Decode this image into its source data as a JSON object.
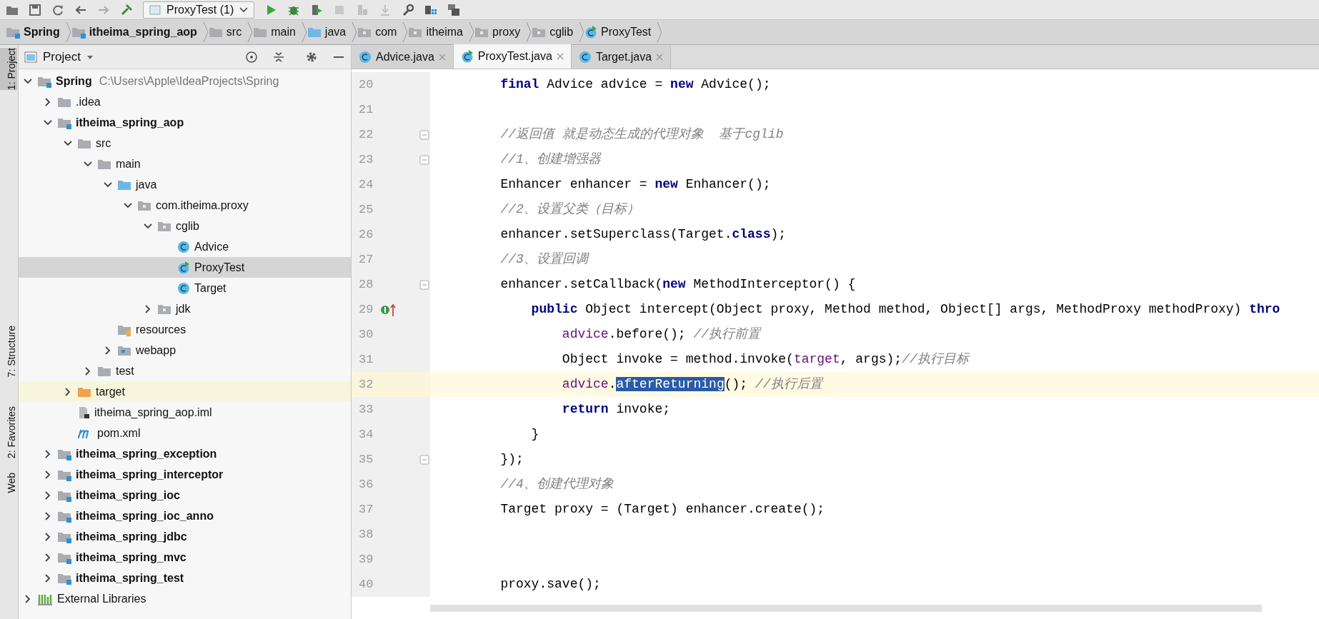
{
  "toolbar": {
    "run_config": "ProxyTest (1)"
  },
  "breadcrumbs": [
    {
      "label": "Spring",
      "kind": "module"
    },
    {
      "label": "itheima_spring_aop",
      "kind": "module"
    },
    {
      "label": "src",
      "kind": "folder"
    },
    {
      "label": "main",
      "kind": "folder"
    },
    {
      "label": "java",
      "kind": "source"
    },
    {
      "label": "com",
      "kind": "package"
    },
    {
      "label": "itheima",
      "kind": "package"
    },
    {
      "label": "proxy",
      "kind": "package"
    },
    {
      "label": "cglib",
      "kind": "package"
    },
    {
      "label": "ProxyTest",
      "kind": "runclass"
    }
  ],
  "side_strip": [
    {
      "label": "1: Project",
      "selected": true
    },
    {
      "label": "7: Structure",
      "selected": false
    },
    {
      "label": "2: Favorites",
      "selected": false
    },
    {
      "label": "Web",
      "selected": false
    }
  ],
  "project_panel": {
    "title": "Project",
    "tree": [
      {
        "label": "Spring",
        "path": "C:\\Users\\Apple\\IdeaProjects\\Spring",
        "kind": "module",
        "expanded": true,
        "selected": false,
        "highlighted": false,
        "children": [
          {
            "label": ".idea",
            "kind": "folder",
            "expanded": false,
            "selected": false,
            "highlighted": false
          },
          {
            "label": "itheima_spring_aop",
            "kind": "module",
            "expanded": true,
            "selected": false,
            "highlighted": false,
            "children": [
              {
                "label": "src",
                "kind": "folder",
                "expanded": true,
                "selected": false,
                "highlighted": false,
                "children": [
                  {
                    "label": "main",
                    "kind": "folder",
                    "expanded": true,
                    "selected": false,
                    "highlighted": false,
                    "children": [
                      {
                        "label": "java",
                        "kind": "source",
                        "expanded": true,
                        "selected": false,
                        "highlighted": false,
                        "children": [
                          {
                            "label": "com.itheima.proxy",
                            "kind": "package",
                            "expanded": true,
                            "selected": false,
                            "highlighted": false,
                            "children": [
                              {
                                "label": "cglib",
                                "kind": "package",
                                "expanded": true,
                                "selected": false,
                                "highlighted": false,
                                "children": [
                                  {
                                    "label": "Advice",
                                    "kind": "class",
                                    "selected": false,
                                    "highlighted": false
                                  },
                                  {
                                    "label": "ProxyTest",
                                    "kind": "runclass",
                                    "selected": true,
                                    "highlighted": false
                                  },
                                  {
                                    "label": "Target",
                                    "kind": "class",
                                    "selected": false,
                                    "highlighted": false
                                  }
                                ]
                              },
                              {
                                "label": "jdk",
                                "kind": "package",
                                "expanded": false,
                                "selected": false,
                                "highlighted": false
                              }
                            ]
                          }
                        ]
                      },
                      {
                        "label": "resources",
                        "kind": "resources",
                        "selected": false,
                        "highlighted": false
                      },
                      {
                        "label": "webapp",
                        "kind": "webapp",
                        "expanded": false,
                        "selected": false,
                        "highlighted": false
                      }
                    ]
                  },
                  {
                    "label": "test",
                    "kind": "folder",
                    "expanded": false,
                    "selected": false,
                    "highlighted": false
                  }
                ]
              },
              {
                "label": "target",
                "kind": "excluded",
                "expanded": false,
                "selected": false,
                "highlighted": true
              },
              {
                "label": "itheima_spring_aop.iml",
                "kind": "iml",
                "selected": false,
                "highlighted": false
              },
              {
                "label": "pom.xml",
                "kind": "pom",
                "selected": false,
                "highlighted": false
              }
            ]
          },
          {
            "label": "itheima_spring_exception",
            "kind": "module",
            "expanded": false,
            "selected": false,
            "highlighted": false
          },
          {
            "label": "itheima_spring_interceptor",
            "kind": "module",
            "expanded": false,
            "selected": false,
            "highlighted": false
          },
          {
            "label": "itheima_spring_ioc",
            "kind": "module",
            "expanded": false,
            "selected": false,
            "highlighted": false
          },
          {
            "label": "itheima_spring_ioc_anno",
            "kind": "module",
            "expanded": false,
            "selected": false,
            "highlighted": false
          },
          {
            "label": "itheima_spring_jdbc",
            "kind": "module",
            "expanded": false,
            "selected": false,
            "highlighted": false
          },
          {
            "label": "itheima_spring_mvc",
            "kind": "module",
            "expanded": false,
            "selected": false,
            "highlighted": false
          },
          {
            "label": "itheima_spring_test",
            "kind": "module",
            "expanded": false,
            "selected": false,
            "highlighted": false
          }
        ]
      },
      {
        "label": "External Libraries",
        "kind": "libraries",
        "expanded": false,
        "selected": false,
        "highlighted": false
      }
    ]
  },
  "editor_tabs": [
    {
      "label": "Advice.java",
      "kind": "class",
      "selected": false
    },
    {
      "label": "ProxyTest.java",
      "kind": "runclass",
      "selected": true
    },
    {
      "label": "Target.java",
      "kind": "class",
      "selected": false
    }
  ],
  "code": [
    {
      "number": "20",
      "fold": false,
      "current": false,
      "tokens": [
        {
          "text": "        final",
          "kind": "kw"
        },
        {
          "text": " Advice advice = ",
          "kind": "plain"
        },
        {
          "text": "new",
          "kind": "kw"
        },
        {
          "text": " Advice();",
          "kind": "plain"
        }
      ]
    },
    {
      "number": "21",
      "fold": false,
      "current": false
    },
    {
      "number": "22",
      "fold": true,
      "current": false,
      "tokens": [
        {
          "text": "        //返回值 就是动态生成的代理对象  基于cglib",
          "kind": "comment"
        }
      ]
    },
    {
      "number": "23",
      "fold": true,
      "current": false,
      "tokens": [
        {
          "text": "        //1、创建增强器",
          "kind": "comment"
        }
      ]
    },
    {
      "number": "24",
      "fold": false,
      "current": false,
      "tokens": [
        {
          "text": "        Enhancer enhancer = ",
          "kind": "plain"
        },
        {
          "text": "new",
          "kind": "kw"
        },
        {
          "text": " Enhancer();",
          "kind": "plain"
        }
      ]
    },
    {
      "number": "25",
      "fold": false,
      "current": false,
      "tokens": [
        {
          "text": "        //2、设置父类（目标）",
          "kind": "comment"
        }
      ]
    },
    {
      "number": "26",
      "fold": false,
      "current": false,
      "tokens": [
        {
          "text": "        enhancer.setSuperclass(Target.",
          "kind": "plain"
        },
        {
          "text": "class",
          "kind": "kw"
        },
        {
          "text": ");",
          "kind": "plain"
        }
      ]
    },
    {
      "number": "27",
      "fold": false,
      "current": false,
      "tokens": [
        {
          "text": "        //3、设置回调",
          "kind": "comment"
        }
      ]
    },
    {
      "number": "28",
      "fold": true,
      "current": false,
      "tokens": [
        {
          "text": "        enhancer.setCallback(",
          "kind": "plain"
        },
        {
          "text": "new",
          "kind": "kw"
        },
        {
          "text": " MethodInterceptor() {",
          "kind": "plain"
        }
      ]
    },
    {
      "number": "29",
      "fold": false,
      "current": false,
      "implements": true,
      "tokens": [
        {
          "text": "            public",
          "kind": "kw"
        },
        {
          "text": " Object intercept(Object proxy, Method method, Object[] args, MethodProxy methodProxy) ",
          "kind": "plain"
        },
        {
          "text": "thro",
          "kind": "kw"
        }
      ]
    },
    {
      "number": "30",
      "fold": false,
      "current": false,
      "tokens": [
        {
          "text": "                advice",
          "kind": "field"
        },
        {
          "text": ".before(); ",
          "kind": "plain"
        },
        {
          "text": "//执行前置",
          "kind": "comment"
        }
      ]
    },
    {
      "number": "31",
      "fold": false,
      "current": false,
      "tokens": [
        {
          "text": "                Object invoke = method.invoke(",
          "kind": "plain"
        },
        {
          "text": "target",
          "kind": "field"
        },
        {
          "text": ", args);",
          "kind": "plain"
        },
        {
          "text": "//执行目标",
          "kind": "comment"
        }
      ]
    },
    {
      "number": "32",
      "fold": false,
      "current": true,
      "tokens": [
        {
          "text": "                advice",
          "kind": "field"
        },
        {
          "text": ".",
          "kind": "plain"
        },
        {
          "text": "afterReturning",
          "kind": "selection"
        },
        {
          "text": "(); ",
          "kind": "plain"
        },
        {
          "text": "//执行后置",
          "kind": "comment"
        }
      ]
    },
    {
      "number": "33",
      "fold": false,
      "current": false,
      "tokens": [
        {
          "text": "                return",
          "kind": "kw"
        },
        {
          "text": " invoke;",
          "kind": "plain"
        }
      ]
    },
    {
      "number": "34",
      "fold": false,
      "current": false,
      "tokens": [
        {
          "text": "            }",
          "kind": "plain"
        }
      ]
    },
    {
      "number": "35",
      "fold": true,
      "current": false,
      "tokens": [
        {
          "text": "        });",
          "kind": "plain"
        }
      ]
    },
    {
      "number": "36",
      "fold": false,
      "current": false,
      "tokens": [
        {
          "text": "        //4、创建代理对象",
          "kind": "comment"
        }
      ]
    },
    {
      "number": "37",
      "fold": false,
      "current": false,
      "tokens": [
        {
          "text": "        Target proxy = (Target) enhancer.create();",
          "kind": "plain"
        }
      ]
    },
    {
      "number": "38",
      "fold": false,
      "current": false
    },
    {
      "number": "39",
      "fold": false,
      "current": false
    },
    {
      "number": "40",
      "fold": false,
      "current": false,
      "tokens": [
        {
          "text": "        proxy.save();",
          "kind": "plain"
        }
      ]
    }
  ]
}
